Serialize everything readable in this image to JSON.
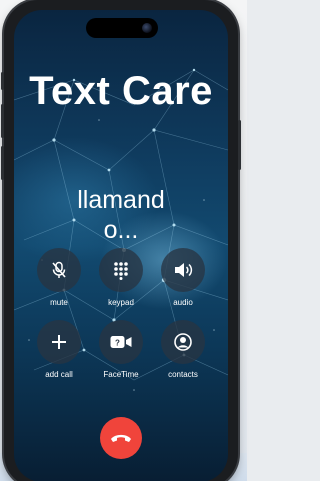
{
  "call": {
    "caller_name": "Text Care",
    "status_line1": "llamand",
    "status_line2": "o..."
  },
  "controls": {
    "mute": {
      "label": "mute",
      "icon": "mic-slash-icon"
    },
    "keypad": {
      "label": "keypad",
      "icon": "keypad-icon"
    },
    "audio": {
      "label": "audio",
      "icon": "speaker-icon"
    },
    "add_call": {
      "label": "add call",
      "icon": "plus-icon"
    },
    "facetime": {
      "label": "FaceTime",
      "icon": "video-camera-icon"
    },
    "contacts": {
      "label": "contacts",
      "icon": "person-circle-icon"
    }
  },
  "end_call": {
    "icon": "phone-hangup-icon",
    "color": "#f0443b"
  },
  "colors": {
    "screen_top": "#0a2540",
    "screen_mid": "#124a70",
    "button_bg": "#283442"
  }
}
